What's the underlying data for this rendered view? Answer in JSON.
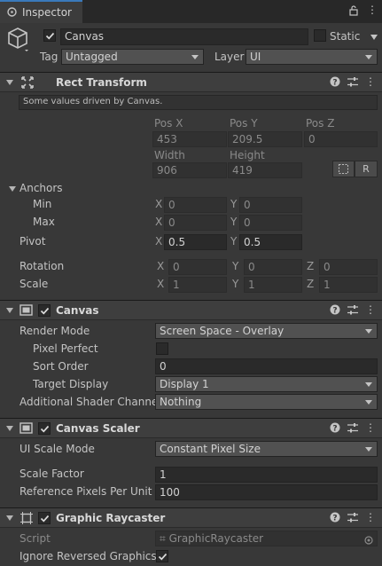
{
  "tab": {
    "title": "Inspector"
  },
  "object": {
    "name": "Canvas",
    "static_label": "Static",
    "tag_label": "Tag",
    "tag_value": "Untagged",
    "layer_label": "Layer",
    "layer_value": "UI"
  },
  "rect_transform": {
    "title": "Rect Transform",
    "info": "Some values driven by Canvas.",
    "pos_x_label": "Pos X",
    "pos_y_label": "Pos Y",
    "pos_z_label": "Pos Z",
    "pos_x": "453",
    "pos_y": "209.5",
    "pos_z": "0",
    "width_label": "Width",
    "height_label": "Height",
    "width": "906",
    "height": "419",
    "r_button": "R",
    "anchors_label": "Anchors",
    "min_label": "Min",
    "min_x": "0",
    "min_y": "0",
    "max_label": "Max",
    "max_x": "0",
    "max_y": "0",
    "pivot_label": "Pivot",
    "pivot_x": "0.5",
    "pivot_y": "0.5",
    "rotation_label": "Rotation",
    "rot_x": "0",
    "rot_y": "0",
    "rot_z": "0",
    "scale_label": "Scale",
    "scale_x": "1",
    "scale_y": "1",
    "scale_z": "1",
    "axis_x": "X",
    "axis_y": "Y",
    "axis_z": "Z"
  },
  "canvas": {
    "title": "Canvas",
    "render_mode_label": "Render Mode",
    "render_mode": "Screen Space - Overlay",
    "pixel_perfect_label": "Pixel Perfect",
    "sort_order_label": "Sort Order",
    "sort_order": "0",
    "target_display_label": "Target Display",
    "target_display": "Display 1",
    "shader_channels_label": "Additional Shader Channels",
    "shader_channels": "Nothing"
  },
  "canvas_scaler": {
    "title": "Canvas Scaler",
    "ui_scale_mode_label": "UI Scale Mode",
    "ui_scale_mode": "Constant Pixel Size",
    "scale_factor_label": "Scale Factor",
    "scale_factor": "1",
    "ref_ppu_label": "Reference Pixels Per Unit",
    "ref_ppu": "100"
  },
  "graphic_raycaster": {
    "title": "Graphic Raycaster",
    "script_label": "Script",
    "script_value": "GraphicRaycaster",
    "ignore_reversed_label": "Ignore Reversed Graphics"
  }
}
